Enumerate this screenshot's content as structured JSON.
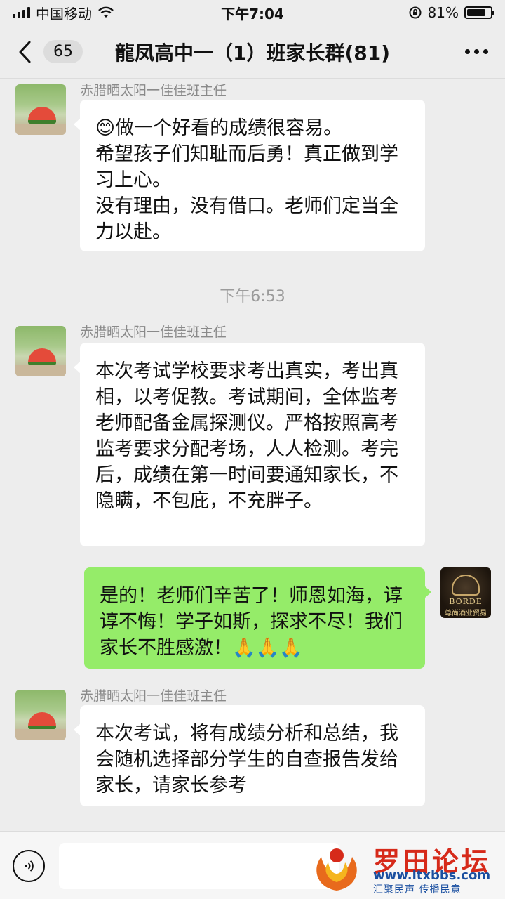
{
  "status_bar": {
    "carrier": "中国移动",
    "time": "下午7:04",
    "battery_percent": "81%",
    "battery_level": 0.81
  },
  "nav": {
    "back_icon": "chevron-left-icon",
    "unread_count": "65",
    "title": "龍凤高中一（1）班家长群(81)",
    "more_icon": "more-dots-icon"
  },
  "messages": [
    {
      "sender": "赤腊晒太阳一佳佳班主任",
      "emoji": "😊",
      "text": "做一个好看的成绩很容易。\n希望孩子们知耻而后勇！真正做到学习上心。\n没有理由，没有借口。老师们定当全力以赴。"
    },
    {
      "sender": "赤腊晒太阳一佳佳班主任",
      "text": "本次考试学校要求考出真实，考出真相，以考促教。考试期间，全体监考老师配备金属探测仪。严格按照高考监考要求分配考场，人人检测。考完后，成绩在第一时间要通知家长，不隐瞒，不包庇，不充胖子。"
    },
    {
      "sender": "self",
      "text": "是的！老师们辛苦了！师恩如海，谆谆不悔！学子如斯，探求不尽！我们家长不胜感激！",
      "emoji_tail": "🙏🙏🙏"
    },
    {
      "sender": "赤腊晒太阳一佳佳班主任",
      "text": "本次考试，将有成绩分析和总结，我会随机选择部分学生的自查报告发给家长，请家长参考"
    }
  ],
  "time_separator": "下午6:53",
  "self_avatar": {
    "brand": "BORDE",
    "brand_cn": "尊尚酒业贸易"
  },
  "input_bar": {
    "voice_icon": "voice-icon",
    "placeholder": ""
  },
  "watermark": {
    "title": "罗田论坛",
    "url": "www.ltxbbs.com",
    "slogan": "汇聚民声 传播民意"
  },
  "colors": {
    "background": "#ededed",
    "bubble_in": "#ffffff",
    "bubble_out": "#95ec69",
    "name_gray": "#8a8a8a"
  }
}
